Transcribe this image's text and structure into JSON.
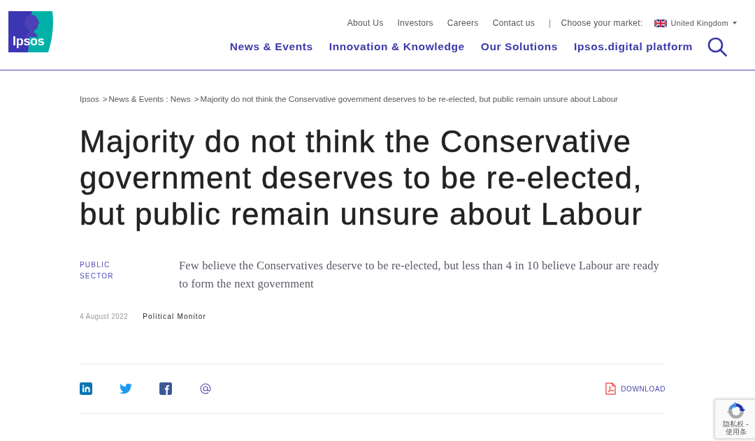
{
  "header": {
    "logo": {
      "text": "Ipsos"
    },
    "top_links": [
      "About Us",
      "Investors",
      "Careers",
      "Contact us"
    ],
    "divider": "|",
    "market": {
      "label": "Choose your market:",
      "value": "United Kingdom"
    },
    "nav": [
      "News & Events",
      "Innovation & Knowledge",
      "Our Solutions",
      "Ipsos.digital platform"
    ]
  },
  "breadcrumb": [
    {
      "kind": "link",
      "text": "Ipsos"
    },
    {
      "kind": "separator",
      "text": ">"
    },
    {
      "kind": "link",
      "text": "News & Events : News"
    },
    {
      "kind": "separator",
      "text": ">"
    },
    {
      "kind": "current",
      "text": "Majority do not think the Conservative government deserves to be re-elected, but public remain unsure about Labour"
    }
  ],
  "article": {
    "title": "Majority do not think the Conservative government deserves to be re-elected, but public remain unsure about Labour",
    "category": "PUBLIC SECTOR",
    "summary": "Few believe the Conservatives deserve to be re-elected, but less than 4 in 10 believe Labour are ready to form the next government",
    "date": "4 August 2022",
    "series": "Political Monitor"
  },
  "share": {
    "download": "DOWNLOAD"
  },
  "recaptcha": {
    "links": "隐私权 - 使用条"
  }
}
